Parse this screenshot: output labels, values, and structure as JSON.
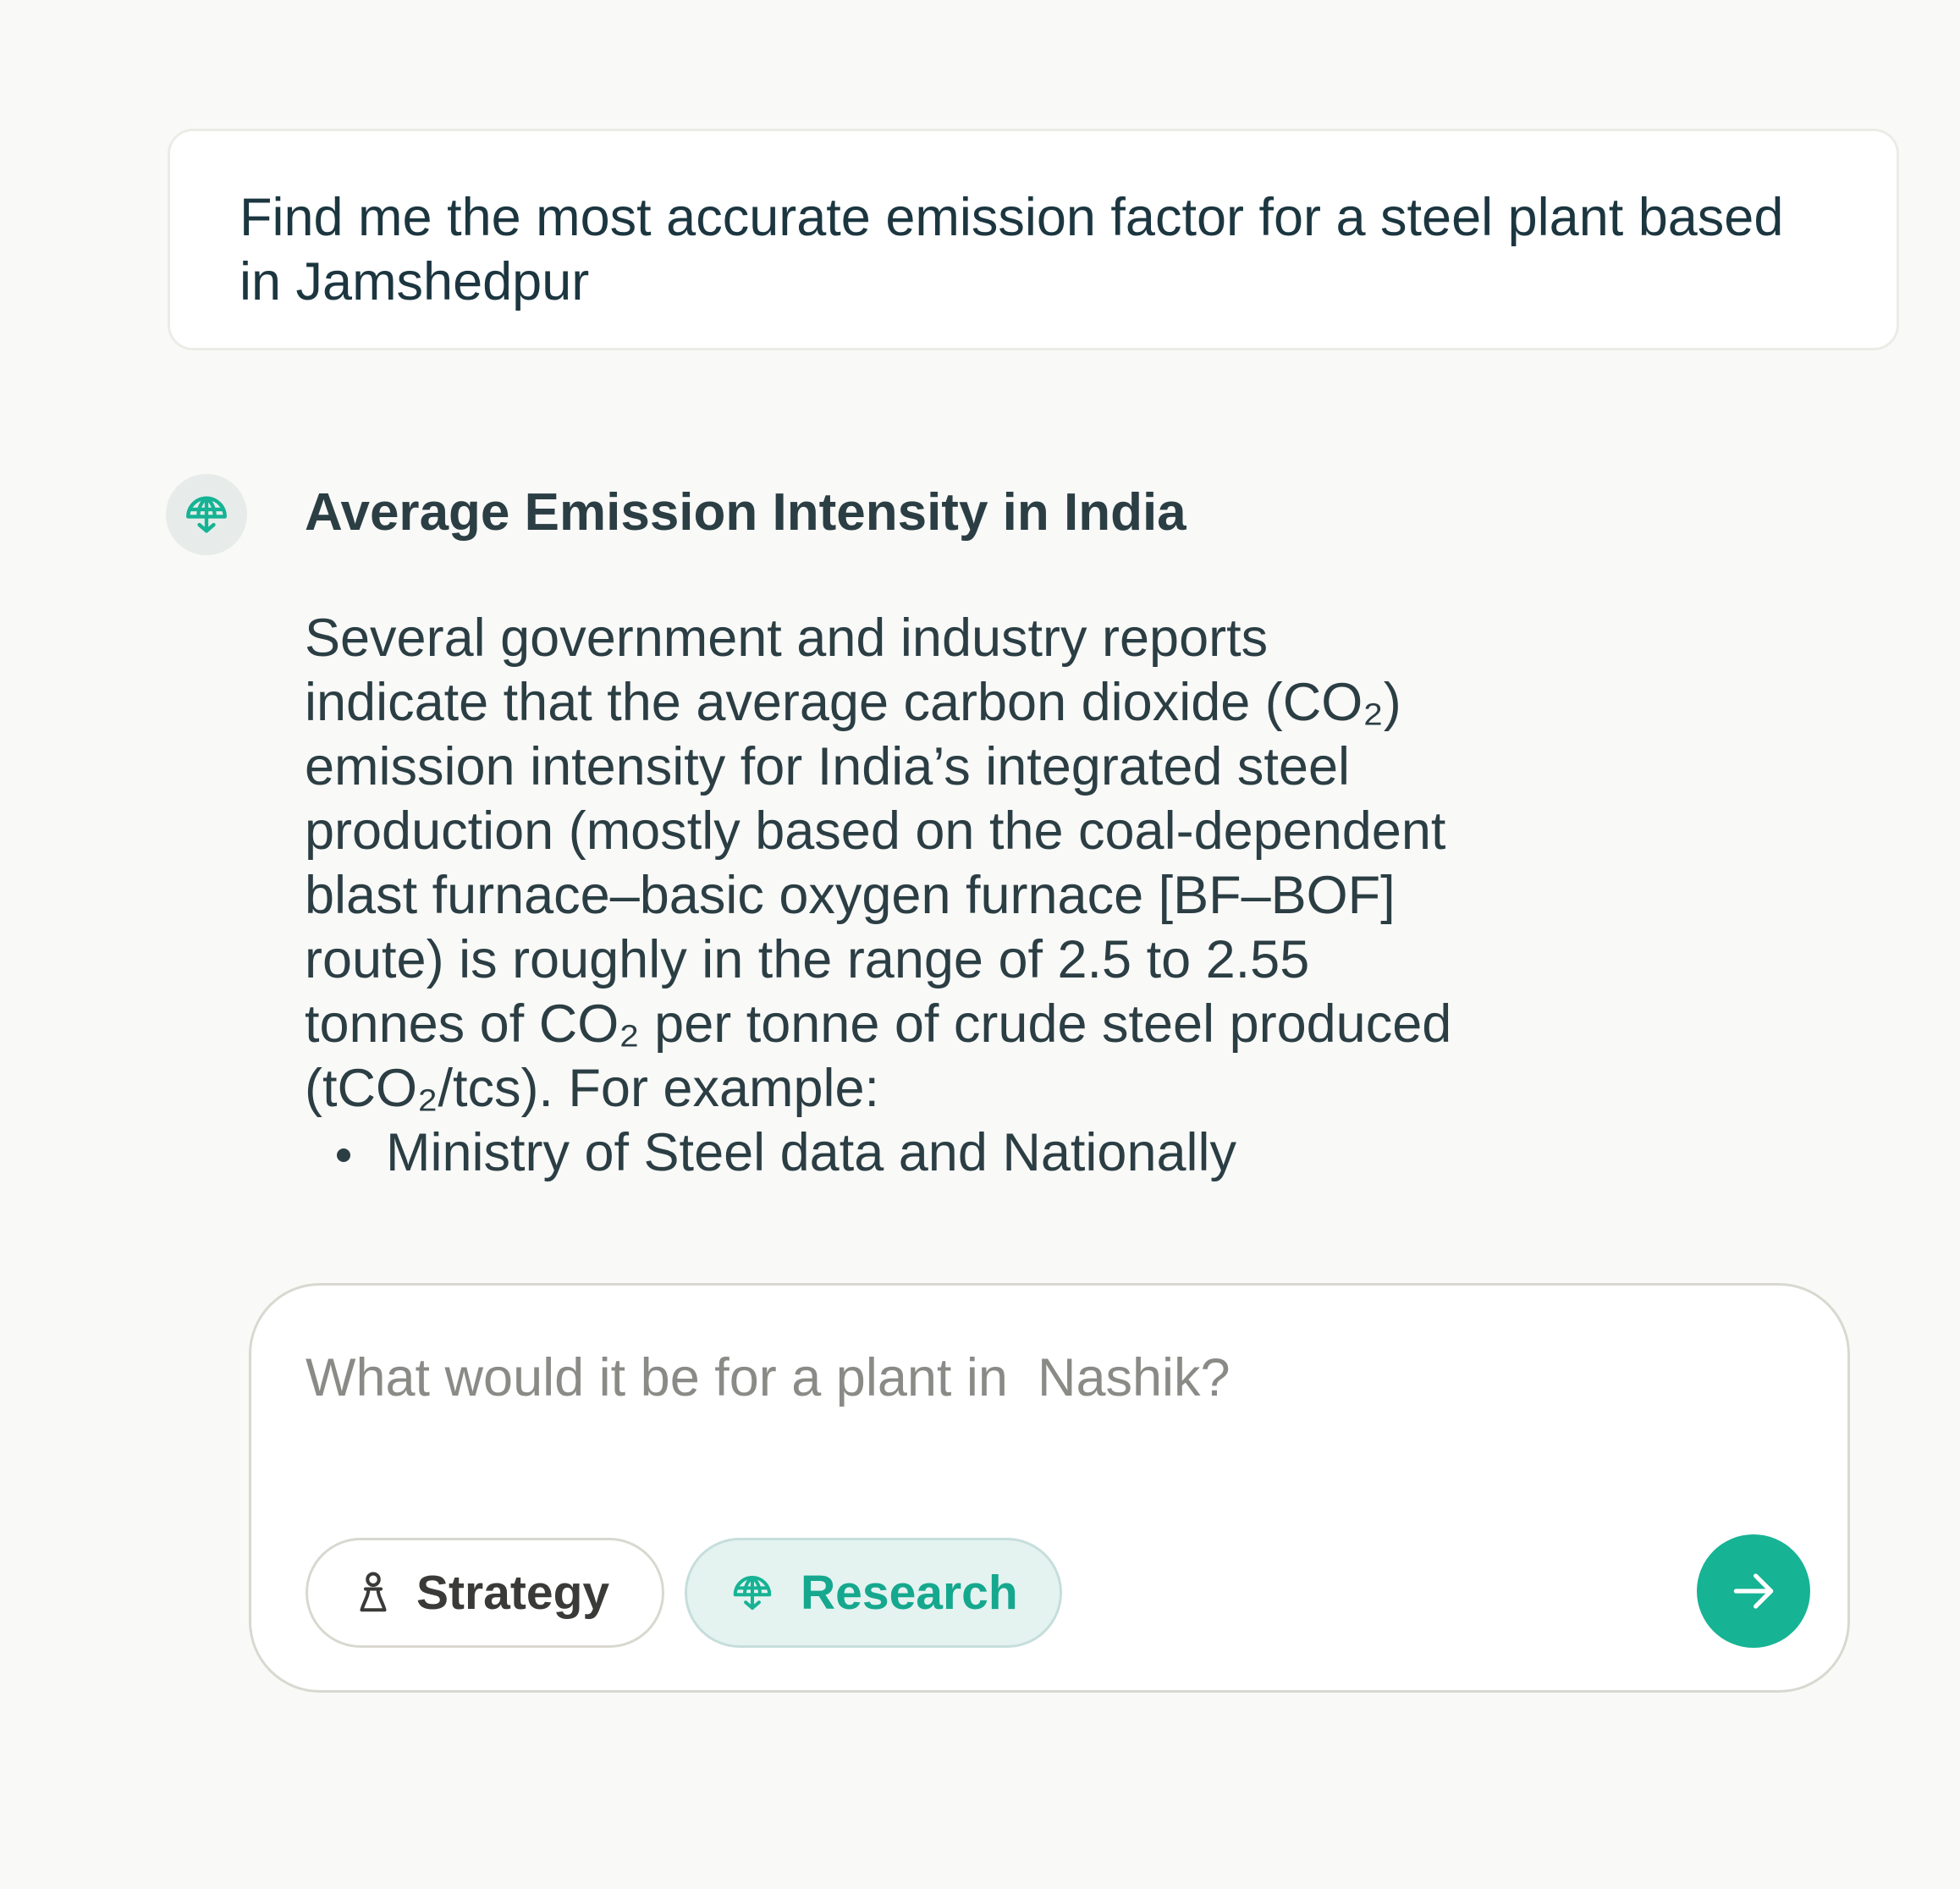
{
  "conversation": {
    "user_message": "Find me the most accurate emission factor for a steel plant based in Jamshedpur",
    "assistant": {
      "avatar_icon": "globe-umbrella-icon",
      "heading": "Average Emission Intensity in India",
      "paragraph": "Several government and industry reports\nindicate that the average carbon dioxide (CO₂)\nemission intensity for India’s integrated steel\nproduction (mostly based on the coal-dependent\nblast furnace–basic oxygen furnace [BF–BOF]\nroute) is roughly in the range of 2.5 to 2.55\ntonnes of CO₂ per tonne of crude steel produced\n(tCO₂/tcs). For example:",
      "bullets": [
        "Ministry of Steel data and Nationally"
      ]
    }
  },
  "composer": {
    "input_value": "",
    "placeholder": "What would it be for a plant in  Nashik?",
    "chips": {
      "strategy": {
        "label": "Strategy",
        "icon": "chess-pawn-icon",
        "selected": false
      },
      "research": {
        "label": "Research",
        "icon": "globe-umbrella-icon",
        "selected": true
      }
    },
    "send_icon": "arrow-right-icon"
  },
  "colors": {
    "background": "#f9f9f7",
    "text": "#2b3e44",
    "accent": "#16b394",
    "accent_light": "#e4f3f0",
    "placeholder": "#8a8a86"
  }
}
